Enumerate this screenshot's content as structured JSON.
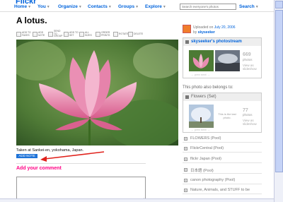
{
  "nav": {
    "logo": "Flickr",
    "items": [
      {
        "label": "Home",
        "caret": "▼"
      },
      {
        "label": "You",
        "caret": "▼"
      },
      {
        "label": "Organize",
        "caret": "▼"
      },
      {
        "label": "Contacts",
        "caret": "▼"
      },
      {
        "label": "Groups",
        "caret": "▼"
      },
      {
        "label": "Explore",
        "caret": "▼"
      }
    ],
    "search_placeholder": "Search everyone's photos",
    "search_label": "Search",
    "search_caret": "▼"
  },
  "photo": {
    "title": "A lotus.",
    "caption": "Taken at Sankei-en, yokohama, Japan.",
    "tag_button": "ADD NOTE",
    "colors": {
      "petal": "#e77aa3",
      "petal_light": "#f4b6cf",
      "leaf": "#3f6b2e",
      "arrow": "#e0211b"
    }
  },
  "toolbar": [
    {
      "label": "ADD TO FAVES",
      "icon": "star-icon"
    },
    {
      "label": "ADD NOTE",
      "icon": "note-icon"
    },
    {
      "label": "SEND TO GROUP",
      "icon": "group-icon"
    },
    {
      "label": "ADD TO SET",
      "icon": "set-icon"
    },
    {
      "label": "ALL SIZES",
      "icon": "sizes-icon"
    },
    {
      "label": "ORDER PRINTS",
      "icon": "prints-icon"
    },
    {
      "label": "ROTATE",
      "icon": "rotate-icon"
    },
    {
      "label": "DELETE",
      "icon": "delete-icon"
    }
  ],
  "comments": {
    "add_label": "Add your comment"
  },
  "sidebar": {
    "uploaded_prefix": "Uploaded on",
    "uploaded_date": "July 20, 2006",
    "by_prefix": "by",
    "uploader": "skyseeker",
    "stream": {
      "title": "skyseeker's photostream",
      "count": "669",
      "count_label": "photos",
      "view_label": "View as slideshow",
      "nav": "← prev  next →"
    },
    "belongs_label": "This photo also belongs to:",
    "set": {
      "title": "Flowers (Set)",
      "mid_text": "This is the last photo.",
      "count": "77",
      "count_label": "photos",
      "view_label": "View as slideshow",
      "nav": "← prev  next →"
    },
    "pools": [
      {
        "label": "FLOWERS (Pool)"
      },
      {
        "label": "FlickrCentral (Pool)"
      },
      {
        "label": "flickr Japan (Pool)"
      },
      {
        "label": "日本語 (Pool)"
      },
      {
        "label": "canon photography (Pool)"
      },
      {
        "label": "Nature, Animals, and STUFF to be"
      }
    ]
  }
}
